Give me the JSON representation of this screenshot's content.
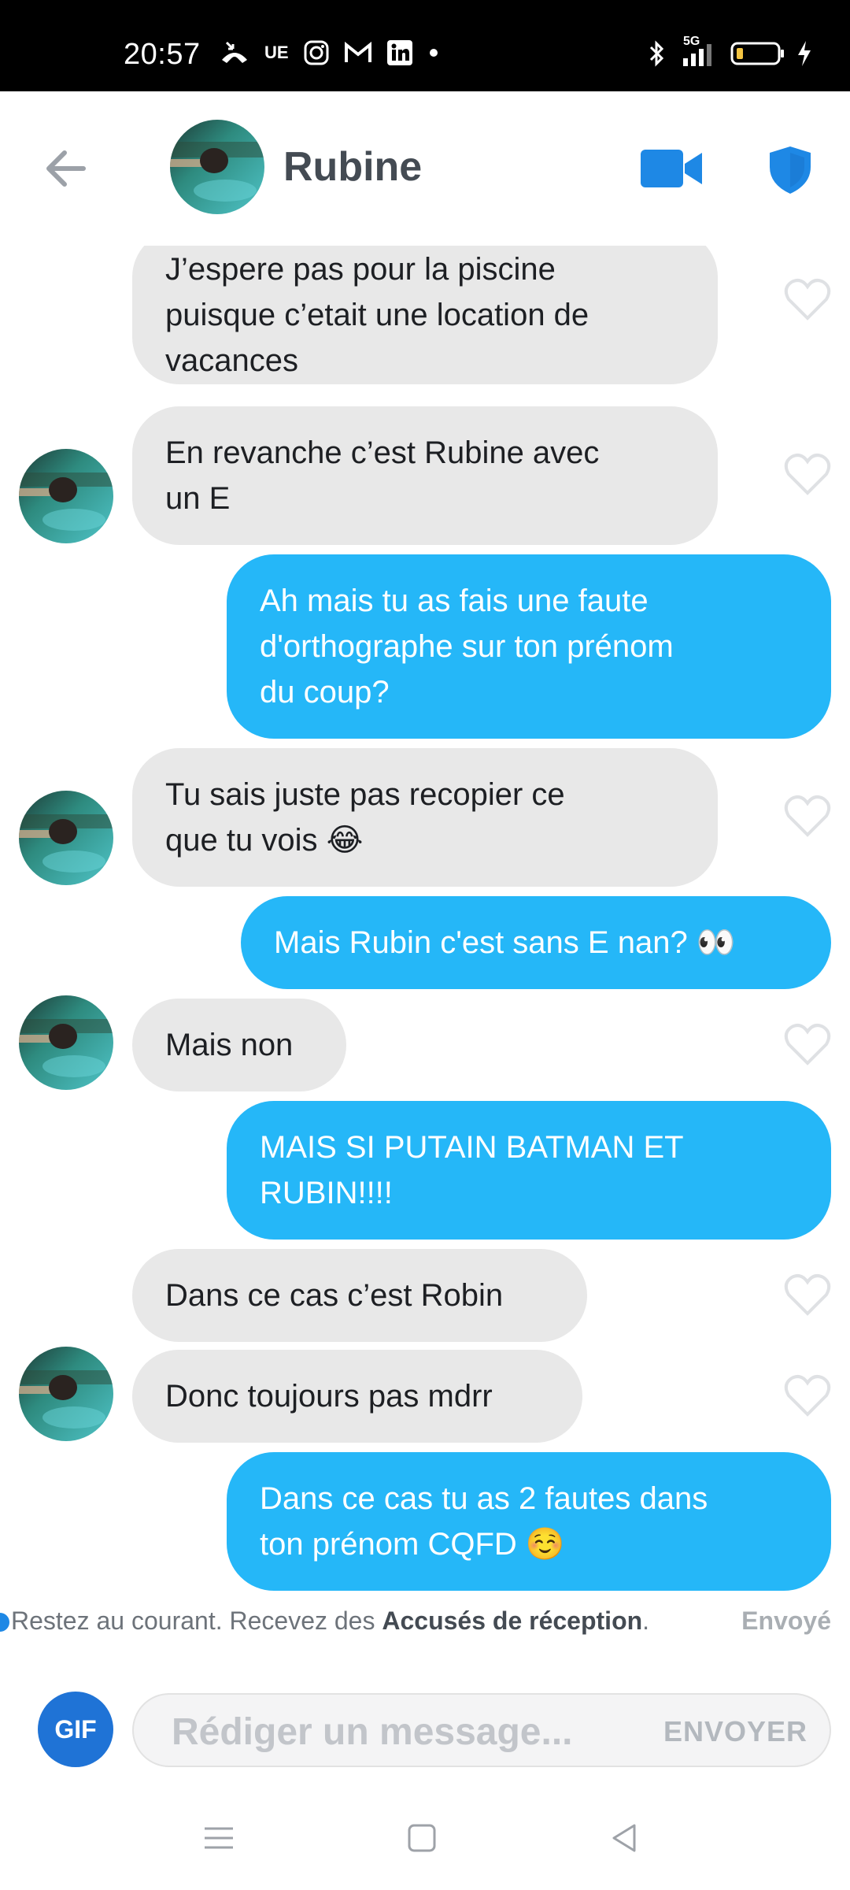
{
  "status_bar": {
    "time": "20:57",
    "left_icons": [
      "missed-call-icon",
      "ue-icon",
      "instagram-icon",
      "gmail-icon",
      "linkedin-icon",
      "dot-icon"
    ],
    "ue_label": "UE",
    "network_label": "5G",
    "right_icons": [
      "bluetooth-icon",
      "signal-icon",
      "battery-icon",
      "charging-icon"
    ]
  },
  "header": {
    "contact_name": "Rubine",
    "icons": [
      "back-arrow-icon",
      "video-call-icon",
      "shield-icon"
    ]
  },
  "messages": [
    {
      "from": "them",
      "lines": [
        "J’espere pas pour la piscine",
        "puisque c’etait une location de",
        "vacances"
      ],
      "avatar": false
    },
    {
      "from": "them",
      "lines": [
        "En revanche c’est Rubine avec",
        "un E"
      ],
      "avatar": true
    },
    {
      "from": "me",
      "lines": [
        "Ah mais tu as fais une faute",
        "d'orthographe sur ton prénom",
        "du coup?"
      ]
    },
    {
      "from": "them",
      "lines": [
        "Tu sais juste pas recopier ce",
        "que tu vois 😂"
      ],
      "avatar": true
    },
    {
      "from": "me",
      "lines": [
        "Mais Rubin c'est sans E nan? 👀"
      ]
    },
    {
      "from": "them",
      "lines": [
        "Mais non"
      ],
      "avatar": true
    },
    {
      "from": "me",
      "lines": [
        "MAIS SI PUTAIN BATMAN ET",
        "RUBIN!!!!"
      ]
    },
    {
      "from": "them",
      "lines": [
        "Dans ce cas c’est Robin"
      ],
      "avatar": false
    },
    {
      "from": "them",
      "lines": [
        "Donc toujours pas mdrr"
      ],
      "avatar": true
    },
    {
      "from": "me",
      "lines": [
        "Dans ce cas tu as 2 fautes dans",
        "ton prénom CQFD ☺️"
      ]
    }
  ],
  "receipt": {
    "text_before": "Restez au courant. Recevez des ",
    "link": "Accusés de réception",
    "text_after": ".",
    "status": "Envoyé"
  },
  "composer": {
    "gif_label": "GIF",
    "placeholder": "Rédiger un message...",
    "send_label": "ENVOYER"
  },
  "nav_bar": {
    "icons": [
      "menu-icon",
      "home-square-icon",
      "back-triangle-icon"
    ]
  },
  "colors": {
    "outgoing_bubble": "#25b7f8",
    "incoming_bubble": "#e8e8e8",
    "accent_blue": "#1e88e5",
    "gif_button": "#1f73d6"
  }
}
